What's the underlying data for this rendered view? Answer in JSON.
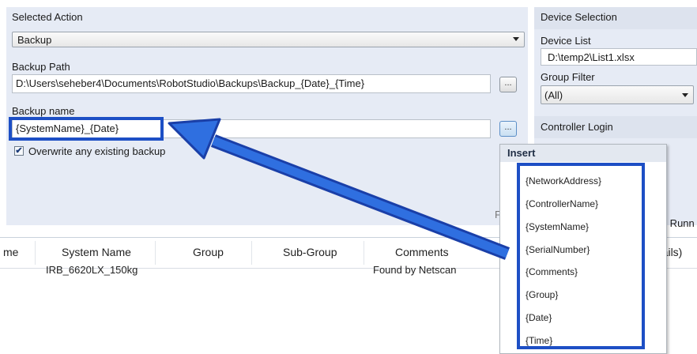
{
  "left_panel": {
    "selected_action_title": "Selected Action",
    "selected_action_value": "Backup",
    "backup_path_label": "Backup Path",
    "backup_path_value": "D:\\Users\\seheber4\\Documents\\RobotStudio\\Backups\\Backup_{Date}_{Time}",
    "backup_path_browse": "...",
    "backup_name_label": "Backup name",
    "backup_name_value": "{SystemName}_{Date}",
    "backup_name_insert": "...",
    "overwrite_label": "Overwrite any existing backup",
    "overwrite_checked": true,
    "partial_label": "F"
  },
  "right_panel": {
    "device_selection_title": "Device Selection",
    "device_list_label": "Device List",
    "device_list_value": "D:\\temp2\\List1.xlsx",
    "group_filter_label": "Group Filter",
    "group_filter_value": "(All)",
    "controller_login_title": "Controller Login",
    "partial_ls": "ls",
    "partial_ate_runn": "ate Runn",
    "partial_etails": "etails)"
  },
  "grid": {
    "columns": [
      "me",
      "System Name",
      "Group",
      "Sub-Group",
      "Comments"
    ],
    "rows": [
      {
        "system_name": "IRB_6620LX_150kg",
        "group": "",
        "sub_group": "",
        "comments": "Found by Netscan"
      }
    ]
  },
  "insert_menu": {
    "title": "Insert",
    "items": [
      "{NetworkAddress}",
      "{ControllerName}",
      "{SystemName}",
      "{SerialNumber}",
      "{Comments}",
      "{Group}",
      "{Date}",
      "{Time}"
    ]
  },
  "annotation_color": "#1d4fc5"
}
